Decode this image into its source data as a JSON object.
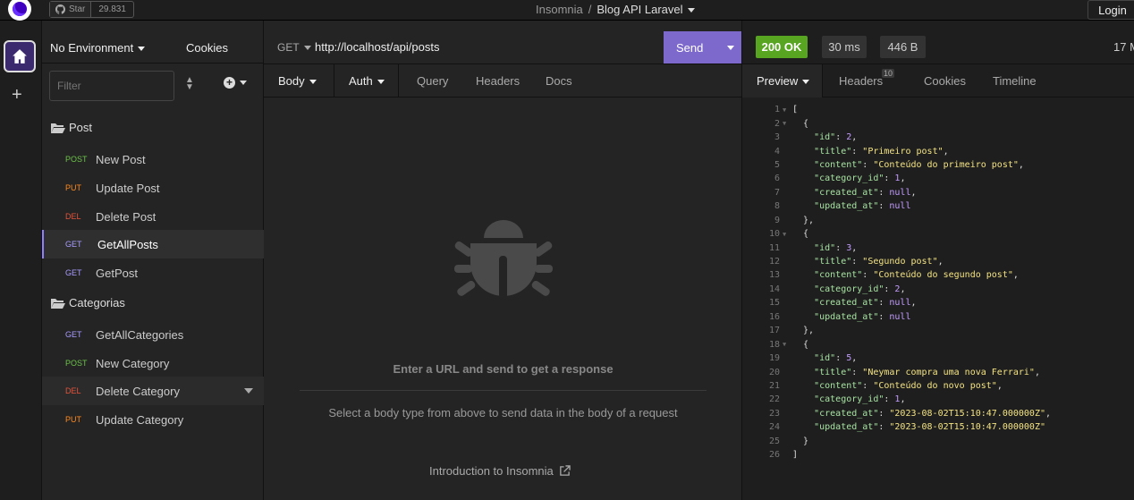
{
  "titlebar": {
    "star_label": "Star",
    "star_count": "29.831",
    "app_name": "Insomnia",
    "separator": "/",
    "project": "Blog API Laravel",
    "login": "Login"
  },
  "sidebar": {
    "environment": "No Environment",
    "cookies": "Cookies",
    "filter_placeholder": "Filter",
    "folders": [
      {
        "name": "Post"
      },
      {
        "name": "Categorias"
      }
    ],
    "requests": [
      {
        "method": "POST",
        "name": "New Post",
        "color": "#6cc24a"
      },
      {
        "method": "PUT",
        "name": "Update Post",
        "color": "#ff8a1f"
      },
      {
        "method": "DEL",
        "name": "Delete Post",
        "color": "#e5533c"
      },
      {
        "method": "GET",
        "name": "GetAllPosts",
        "color": "#a89cff"
      },
      {
        "method": "GET",
        "name": "GetPost",
        "color": "#a89cff"
      },
      {
        "method": "GET",
        "name": "GetAllCategories",
        "color": "#a89cff"
      },
      {
        "method": "POST",
        "name": "New Category",
        "color": "#6cc24a"
      },
      {
        "method": "DEL",
        "name": "Delete Category",
        "color": "#e5533c"
      },
      {
        "method": "PUT",
        "name": "Update Category",
        "color": "#ff8a1f"
      }
    ]
  },
  "request": {
    "method": "GET",
    "url": "http://localhost/api/posts",
    "send": "Send",
    "tabs": [
      "Body",
      "Auth",
      "Query",
      "Headers",
      "Docs"
    ],
    "empty_title": "Enter a URL and send to get a response",
    "empty_hint": "Select a body type from above to send data in the body of a request",
    "intro_link": "Introduction to Insomnia"
  },
  "response": {
    "status": "200 OK",
    "time": "30 ms",
    "size": "446 B",
    "ago": "17 M",
    "tabs": [
      "Preview",
      "Headers",
      "Cookies",
      "Timeline"
    ],
    "headers_count": "10",
    "body": [
      {
        "id": 2,
        "title": "Primeiro post",
        "content": "Conteúdo do primeiro post",
        "category_id": 1,
        "created_at": "null",
        "updated_at": "null"
      },
      {
        "id": 3,
        "title": "Segundo post",
        "content": "Conteúdo do segundo post",
        "category_id": 2,
        "created_at": "null",
        "updated_at": "null"
      },
      {
        "id": 5,
        "title": "Neymar compra uma nova Ferrari",
        "content": "Conteúdo do novo post",
        "category_id": 1,
        "created_at": "2023-08-02T15:10:47.000000Z",
        "updated_at": "2023-08-02T15:10:47.000000Z"
      }
    ]
  }
}
